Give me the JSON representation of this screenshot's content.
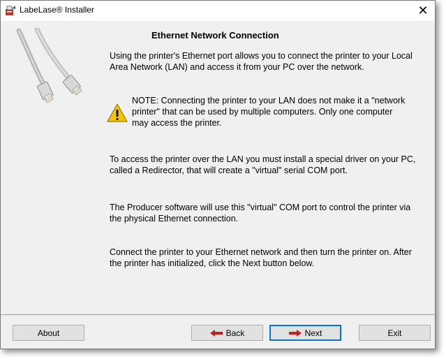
{
  "window": {
    "title": "LabeLase® Installer",
    "close_label": "✕"
  },
  "main": {
    "heading": "Ethernet Network Connection",
    "paragraph1": "Using the printer's Ethernet port allows you to connect the printer to your Local Area Network (LAN) and access it from your PC over the network.",
    "note": "NOTE: Connecting the printer to your LAN does not make it a \"network printer\" that can be used by multiple computers.   Only one computer may access the printer.",
    "paragraph2": "To access the printer over the LAN you must install a special driver on your PC, called a Redirector, that will create a \"virtual\" serial COM port.",
    "paragraph3": "The Producer software will use this \"virtual\" COM port to control the printer via the physical Ethernet connection.",
    "paragraph4": "Connect the printer to your Ethernet network and then turn the printer on.  After the printer has initialized, click the Next button below."
  },
  "buttons": {
    "about": "About",
    "back": "Back",
    "next": "Next",
    "exit": "Exit"
  },
  "icons": {
    "app": "installer-icon",
    "cable": "ethernet-cable-image",
    "warning": "warning-icon",
    "back_arrow": "left-arrow-icon",
    "next_arrow": "right-arrow-icon"
  },
  "colors": {
    "arrow_red": "#c81e1e",
    "warning_yellow": "#f5c400",
    "focus_blue": "#0078d7"
  }
}
